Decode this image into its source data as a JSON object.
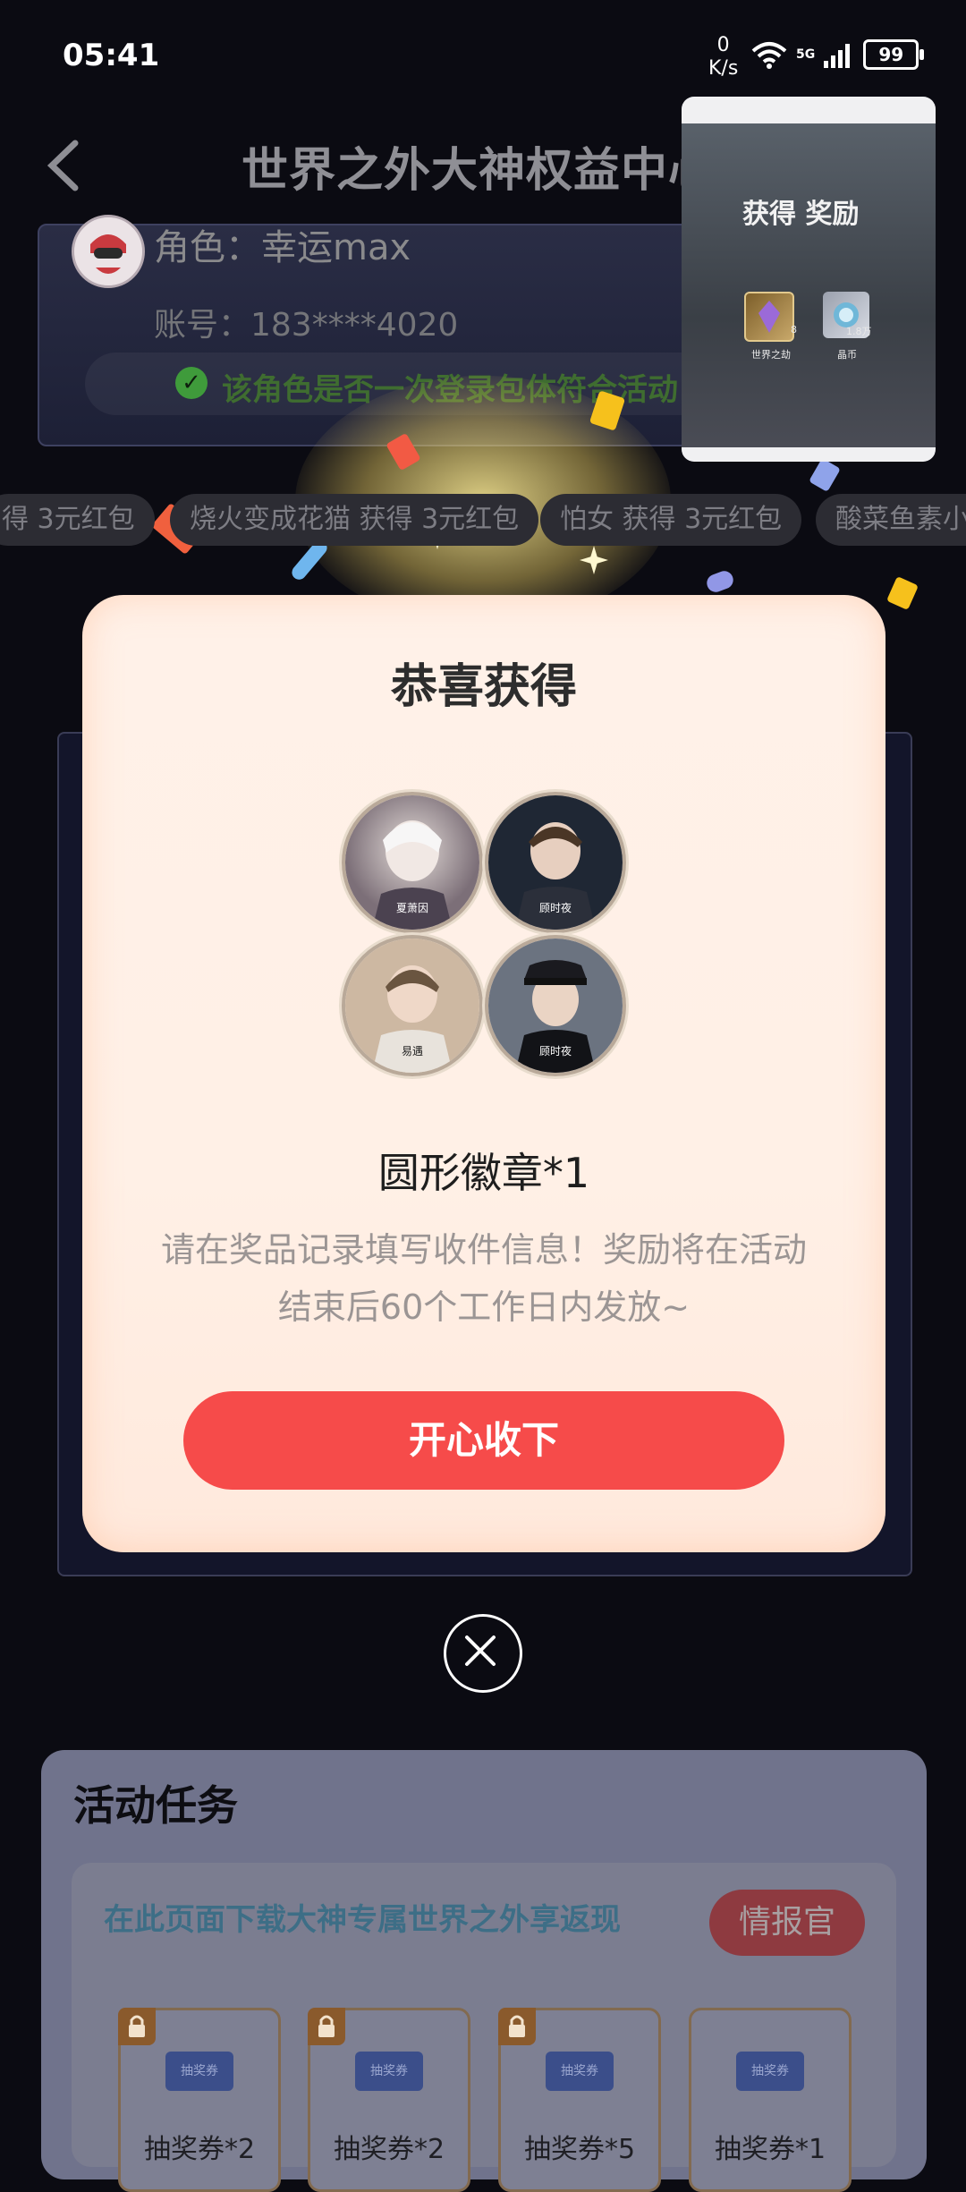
{
  "status_bar": {
    "time": "05:41",
    "net_speed_value": "0",
    "net_speed_unit": "K/s",
    "network": "5G",
    "battery": "99"
  },
  "header": {
    "title": "世界之外大神权益中心",
    "back_icon": "chevron-left-icon"
  },
  "account": {
    "role": "角色：幸运max",
    "account": "账号：183****4020",
    "bind_text": "该角色是否一次登录包体符合活动"
  },
  "ticker": {
    "items": [
      "得 3元红包",
      "烧火变成花猫 获得 3元红包",
      "怕女 获得 3元红包",
      "酸菜鱼素小i"
    ]
  },
  "modal": {
    "title": "恭喜获得",
    "badges": [
      "夏萧因",
      "顾时夜",
      "易遇",
      "顾时夜"
    ],
    "reward_name": "圆形徽章*1",
    "description": "请在奖品记录填写收件信息！奖励将在活动结束后60个工作日内发放~",
    "accept_label": "开心收下",
    "close_icon": "close-icon"
  },
  "activity": {
    "title": "活动任务",
    "promo_text": "在此页面下载大神专属世界之外享返现",
    "intel_button": "情报官",
    "ticket_image_label": "抽奖券",
    "tickets": [
      "抽奖券*2",
      "抽奖券*2",
      "抽奖券*5",
      "抽奖券*1"
    ]
  },
  "pip": {
    "title": "获得 奖励",
    "items": [
      {
        "count": "8",
        "caption": "世界之劫"
      },
      {
        "count": "1.8万",
        "caption": "晶币"
      }
    ]
  },
  "colors": {
    "accent_red": "#f64b4a",
    "modal_bg": "#fff1e8",
    "page_bg": "#0b0b12"
  }
}
